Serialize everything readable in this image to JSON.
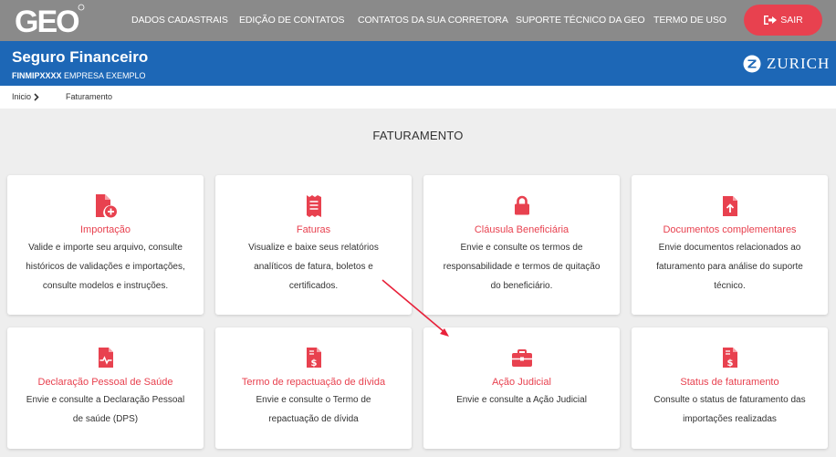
{
  "nav": {
    "logo": "GEO",
    "items": [
      {
        "label": "DADOS CADASTRAIS"
      },
      {
        "label": "EDIÇÃO DE CONTATOS"
      },
      {
        "label": "CONTATOS DA SUA CORRETORA"
      },
      {
        "label": "SUPORTE TÉCNICO DA GEO"
      },
      {
        "label": "TERMO DE USO"
      }
    ],
    "logout_label": "SAIR"
  },
  "header": {
    "title": "Seguro Financeiro",
    "code": "FINMIPXXXX",
    "company": "EMPRESA EXEMPLO",
    "brand": "ZURICH"
  },
  "breadcrumb": {
    "home": "Inicio",
    "current": "Faturamento"
  },
  "page": {
    "title": "FATURAMENTO"
  },
  "cards": [
    {
      "title": "Importação",
      "icon": "file-plus-icon",
      "lines": [
        "Valide e importe seu arquivo, consulte",
        "históricos de validações e importações,",
        "consulte modelos e instruções."
      ]
    },
    {
      "title": "Faturas",
      "icon": "receipt-icon",
      "lines": [
        "Visualize e baixe seus relatórios",
        "analíticos de fatura, boletos e",
        "certificados."
      ]
    },
    {
      "title": "Cláusula Beneficiária",
      "icon": "lock-icon",
      "lines": [
        "Envie e consulte os termos de",
        "responsabilidade e termos de quitação",
        "do beneficiário."
      ]
    },
    {
      "title": "Documentos complementares",
      "icon": "file-upload-icon",
      "lines": [
        "Envie documentos relacionados ao",
        "faturamento para análise do suporte",
        "técnico."
      ]
    },
    {
      "title": "Declaração Pessoal de Saúde",
      "icon": "file-medical-icon",
      "lines": [
        "Envie e consulte a Declaração Pessoal",
        "de saúde (DPS)"
      ]
    },
    {
      "title": "Termo de repactuação de dívida",
      "icon": "file-invoice-dollar-icon",
      "lines": [
        "Envie e consulte o Termo de",
        "repactuação de dívida"
      ]
    },
    {
      "title": "Ação Judicial",
      "icon": "briefcase-icon",
      "lines": [
        "Envie e consulte a Ação Judicial"
      ]
    },
    {
      "title": "Status de faturamento",
      "icon": "file-invoice-dollar-icon",
      "lines": [
        "Consulte o status de faturamento das",
        "importações realizadas"
      ]
    }
  ],
  "colors": {
    "nav_bg": "#8a8a8a",
    "header_bg": "#1d67b6",
    "accent": "#e8414f",
    "page_bg": "#eeeeee"
  }
}
